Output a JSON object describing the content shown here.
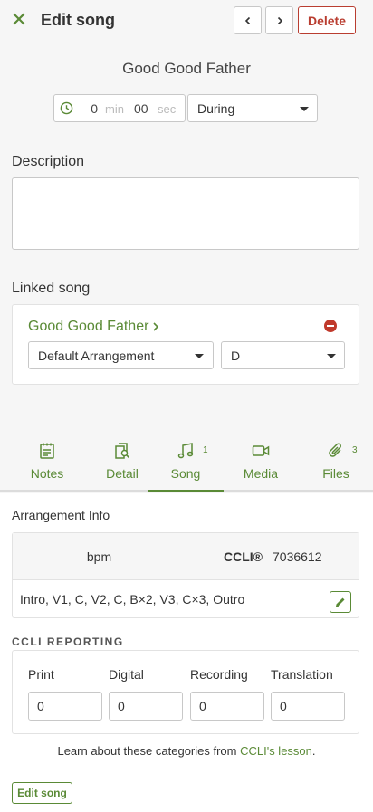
{
  "header": {
    "title": "Edit song",
    "delete_label": "Delete"
  },
  "song": {
    "title": "Good Good Father"
  },
  "timing": {
    "min_value": "0",
    "min_unit": "min",
    "sec_value": "00",
    "sec_unit": "sec",
    "position": "During"
  },
  "description": {
    "label": "Description",
    "value": ""
  },
  "linked": {
    "label": "Linked song",
    "name": "Good Good Father",
    "arrangement": "Default Arrangement",
    "key": "D"
  },
  "tabs": [
    {
      "label": "Notes",
      "badge": ""
    },
    {
      "label": "Detail",
      "badge": ""
    },
    {
      "label": "Song",
      "badge": "1"
    },
    {
      "label": "Media",
      "badge": ""
    },
    {
      "label": "Files",
      "badge": "3"
    }
  ],
  "arrangement_info": {
    "label": "Arrangement Info",
    "bpm_label": "bpm",
    "ccli_label": "CCLI®",
    "ccli_number": "7036612",
    "sequence": "Intro, V1, C, V2, C, B×2, V3, C×3, Outro"
  },
  "ccli_reporting": {
    "label": "CCLI REPORTING",
    "fields": [
      {
        "label": "Print",
        "value": "0"
      },
      {
        "label": "Digital",
        "value": "0"
      },
      {
        "label": "Recording",
        "value": "0"
      },
      {
        "label": "Translation",
        "value": "0"
      }
    ],
    "learn_prefix": "Learn about these categories from ",
    "learn_link": "CCLI's lesson",
    "learn_suffix": "."
  },
  "footer": {
    "edit_song_label": "Edit song"
  },
  "colors": {
    "accent": "#5a8a36",
    "danger": "#b93d30"
  }
}
